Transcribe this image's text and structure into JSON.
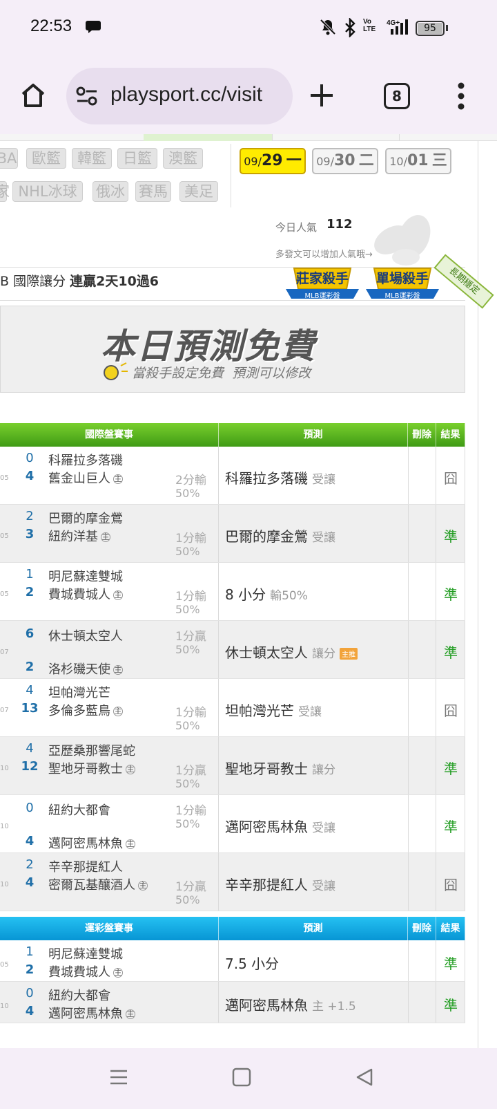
{
  "status_bar": {
    "time": "22:53",
    "battery": "95",
    "network": "4G+"
  },
  "browser": {
    "url": "playsport.cc/visit",
    "tab_count": "8"
  },
  "sport_tabs": {
    "row1": [
      "BA",
      "歐籃",
      "韓籃",
      "日籃",
      "澳籃"
    ],
    "row2": [
      "家",
      "NHL冰球",
      "俄冰",
      "賽馬",
      "美足"
    ]
  },
  "dates": [
    {
      "md": "09/",
      "day": "29",
      "weekday": "一",
      "active": true
    },
    {
      "md": "09/",
      "day": "30",
      "weekday": "二",
      "active": false
    },
    {
      "md": "10/",
      "day": "01",
      "weekday": "三",
      "active": false
    }
  ],
  "popularity": {
    "label": "今日人氣",
    "value": "112",
    "hint": "多發文可以增加人氣哦→"
  },
  "record": {
    "prefix": "B 國際讓分",
    "streak": "連贏2天10過6"
  },
  "badges": [
    {
      "title": "莊家殺手",
      "sub": "MLB運彩盤"
    },
    {
      "title": "單場殺手",
      "sub": "MLB運彩盤"
    },
    {
      "ribbon": "長期穩定"
    }
  ],
  "banner": {
    "title": "本日預測免費",
    "subtitle": "當殺手設定免費  預測可以修改"
  },
  "table1": {
    "headers": [
      "國際盤賽事",
      "預測",
      "刪除",
      "結果"
    ],
    "rows": [
      {
        "time": "05",
        "s1": "0",
        "t1": "科羅拉多落磯",
        "s2": "4",
        "t2": "舊金山巨人",
        "home": "主",
        "odd": "2分輸",
        "pct": "50%",
        "pred": "科羅拉多落磯",
        "pred_sub": "受讓",
        "result": "囧",
        "hit": false,
        "layout": "normal"
      },
      {
        "time": "05",
        "s1": "2",
        "t1": "巴爾的摩金鶯",
        "s2": "3",
        "t2": "紐約洋基",
        "home": "主",
        "odd": "1分輸",
        "pct": "50%",
        "pred": "巴爾的摩金鶯",
        "pred_sub": "受讓",
        "result": "準",
        "hit": true,
        "layout": "normal"
      },
      {
        "time": "05",
        "s1": "1",
        "t1": "明尼蘇達雙城",
        "s2": "2",
        "t2": "費城費城人",
        "home": "主",
        "odd": "1分輸",
        "pct": "50%",
        "pred": "8 小分",
        "pred_sub": "輸50%",
        "result": "準",
        "hit": true,
        "layout": "normal"
      },
      {
        "time": "07",
        "s1": "6",
        "t1": "休士頓太空人",
        "s2": "2",
        "t2": "洛杉磯天使",
        "home": "主",
        "odd": "1分贏",
        "pct": "50%",
        "pred": "休士頓太空人",
        "pred_sub": "讓分",
        "tag": "主推",
        "result": "準",
        "hit": true,
        "layout": "split",
        "bold1": true
      },
      {
        "time": "07",
        "s1": "4",
        "t1": "坦帕灣光芒",
        "s2": "13",
        "t2": "多倫多藍鳥",
        "home": "主",
        "odd": "1分輸",
        "pct": "50%",
        "pred": "坦帕灣光芒",
        "pred_sub": "受讓",
        "result": "囧",
        "hit": false,
        "layout": "normal",
        "bold2": true
      },
      {
        "time": "10",
        "s1": "4",
        "t1": "亞歷桑那響尾蛇",
        "s2": "12",
        "t2": "聖地牙哥教士",
        "home": "主",
        "odd": "1分贏",
        "pct": "50%",
        "pred": "聖地牙哥教士",
        "pred_sub": "讓分",
        "result": "準",
        "hit": true,
        "layout": "normal",
        "bold2": true
      },
      {
        "time": "10",
        "s1": "0",
        "t1": "紐約大都會",
        "s2": "4",
        "t2": "邁阿密馬林魚",
        "home": "主",
        "odd": "1分輸",
        "pct": "50%",
        "pred": "邁阿密馬林魚",
        "pred_sub": "受讓",
        "result": "準",
        "hit": true,
        "layout": "split"
      },
      {
        "time": "10",
        "s1": "2",
        "t1": "辛辛那提紅人",
        "s2": "4",
        "t2": "密爾瓦基釀酒人",
        "home": "主",
        "odd": "1分贏",
        "pct": "50%",
        "pred": "辛辛那提紅人",
        "pred_sub": "受讓",
        "result": "囧",
        "hit": false,
        "layout": "normal"
      }
    ]
  },
  "table2": {
    "headers": [
      "運彩盤賽事",
      "預測",
      "刪除",
      "結果"
    ],
    "rows": [
      {
        "time": "05",
        "s1": "1",
        "t1": "明尼蘇達雙城",
        "s2": "2",
        "t2": "費城費城人",
        "home": "主",
        "pred": "7.5 小分",
        "pred_sub": "",
        "result": "準",
        "hit": true
      },
      {
        "time": "10",
        "s1": "0",
        "t1": "紐約大都會",
        "s2": "4",
        "t2": "邁阿密馬林魚",
        "home": "主",
        "pred": "邁阿密馬林魚",
        "pred_sub": "主 +1.5",
        "result": "準",
        "hit": true
      }
    ]
  },
  "colors": {
    "green_header": "#4fae1c",
    "blue_header": "#0aa6e0",
    "hit": "#1e9b1e",
    "accent_yellow": "#ffeb00"
  },
  "icons": [
    "bell-muted-icon",
    "bluetooth-icon",
    "volte-icon",
    "signal-icon",
    "battery-icon",
    "home-icon",
    "site-settings-icon",
    "plus-icon",
    "tabs-icon",
    "more-icon",
    "menu-icon",
    "square-icon",
    "back-icon"
  ]
}
